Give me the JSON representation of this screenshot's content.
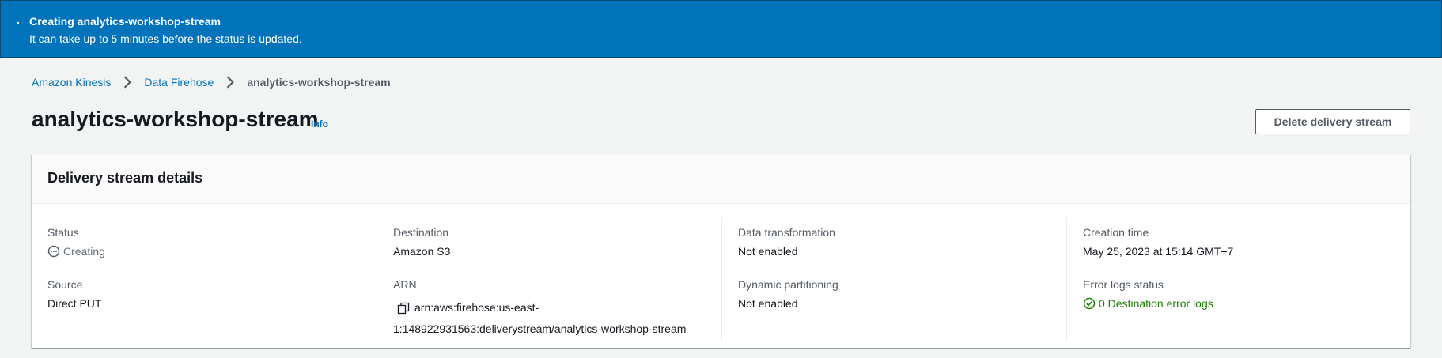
{
  "flash": {
    "dot": ".",
    "title": "Creating analytics-workshop-stream",
    "message": "It can take up to 5 minutes before the status is updated."
  },
  "breadcrumb": {
    "items": [
      "Amazon Kinesis",
      "Data Firehose",
      "analytics-workshop-stream"
    ]
  },
  "header": {
    "title": "analytics-workshop-stream",
    "info": "Info",
    "delete_label": "Delete delivery stream"
  },
  "panel": {
    "title": "Delivery stream details",
    "status_label": "Status",
    "status_value": "Creating",
    "source_label": "Source",
    "source_value": "Direct PUT",
    "destination_label": "Destination",
    "destination_value": "Amazon S3",
    "arn_label": "ARN",
    "arn_line1": "arn:aws:firehose:us-east-",
    "arn_line2": "1:148922931563:deliverystream/analytics-workshop-stream",
    "transformation_label": "Data transformation",
    "transformation_value": "Not enabled",
    "partitioning_label": "Dynamic partitioning",
    "partitioning_value": "Not enabled",
    "creation_label": "Creation time",
    "creation_value": "May 25, 2023 at 15:14 GMT+7",
    "errorlogs_label": "Error logs status",
    "errorlogs_value": "0 Destination error logs"
  },
  "colors": {
    "flash_bg": "#0073bb",
    "link": "#0073bb",
    "success": "#1d8102"
  },
  "icons": [
    "chevron-right-icon",
    "pending-status-icon",
    "copy-icon",
    "success-check-icon"
  ]
}
